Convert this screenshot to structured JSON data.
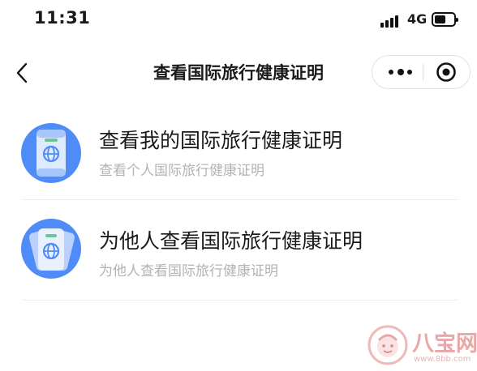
{
  "status_bar": {
    "time": "11:31",
    "network": "4G"
  },
  "nav": {
    "title": "查看国际旅行健康证明"
  },
  "items": [
    {
      "title": "查看我的国际旅行健康证明",
      "subtitle": "查看个人国际旅行健康证明",
      "icon": "passport-card-icon"
    },
    {
      "title": "为他人查看国际旅行健康证明",
      "subtitle": "为他人查看国际旅行健康证明",
      "icon": "passport-cards-icon"
    }
  ],
  "watermark": {
    "text": "八宝网",
    "url": "www.8bb.com"
  },
  "colors": {
    "icon_blue": "#4f8cf7",
    "subtitle_gray": "#b3b3b3",
    "watermark_pink": "#e9a7a7"
  }
}
